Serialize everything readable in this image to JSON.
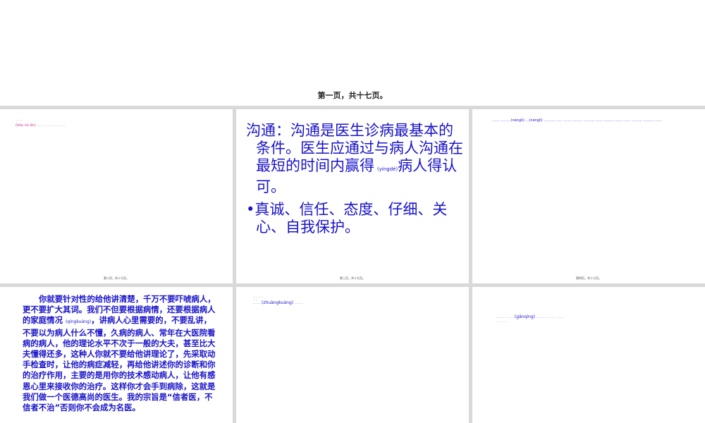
{
  "slides": {
    "s1": {
      "footer": "第一页，共十七页。"
    },
    "s2": {
      "pinyin": "(kǒu nú ǎn)",
      "footer": "第二页，共十七页。"
    },
    "s3": {
      "para1": "沟通：沟通是医生诊病最基本的条件。医生应通过与病人沟通在最短的时间内赢得",
      "para1_pinyin": "(yíngdé)",
      "para1_tail": "病人得认可。",
      "bullet": "•",
      "bullet_text": "真诚、信任、态度、仔细、关心、自我保护。",
      "footer": "第三页，共十七页。"
    },
    "s4": {
      "line_pre": "…… ………",
      "pinyin1": "(nénglì)",
      "line_mid": " …",
      "pinyin2": "(nénglì)",
      "line_post": " ……… …… …… ……… ……… …… ……… …… …… ……… ……… ……",
      "footer": "第四页，共十七页。"
    },
    "s5": {
      "text1": "你就要针对性的给他讲清楚，千万不要吓唬病人，更不要扩大其词。我们不但要根据病情，还要根据病人的家庭情况",
      "pinyin": "(qíngkuàng)",
      "text2": "，讲病人心里需要的，不要乱讲，不要以为病人什么不懂，久病的病人、常年在大医院看病的病人，他的理论水平不次于一般的大夫，甚至比大夫懂得还多，这种人你就不要给他讲理论了，先采取动手检查时，让他的病症减轻，再给他讲述你的诊断和你的治疗作用，主要的是用你的技术感动病人，让他有感恩心里来接收你的治疗。这样你才会手到病除，这就是我们做一个医德高尚的医生。我的宗旨是“信者医，不信者不治”否则你不会成为名医。"
    },
    "s6": {
      "prefix": "……",
      "pinyin": "(zhuàngkuàng)",
      "suffix": " ……"
    },
    "s7": {
      "prefix": "…… ……",
      "pinyin": "(gǎnqíng)",
      "suffix": " …… …… ……"
    }
  }
}
